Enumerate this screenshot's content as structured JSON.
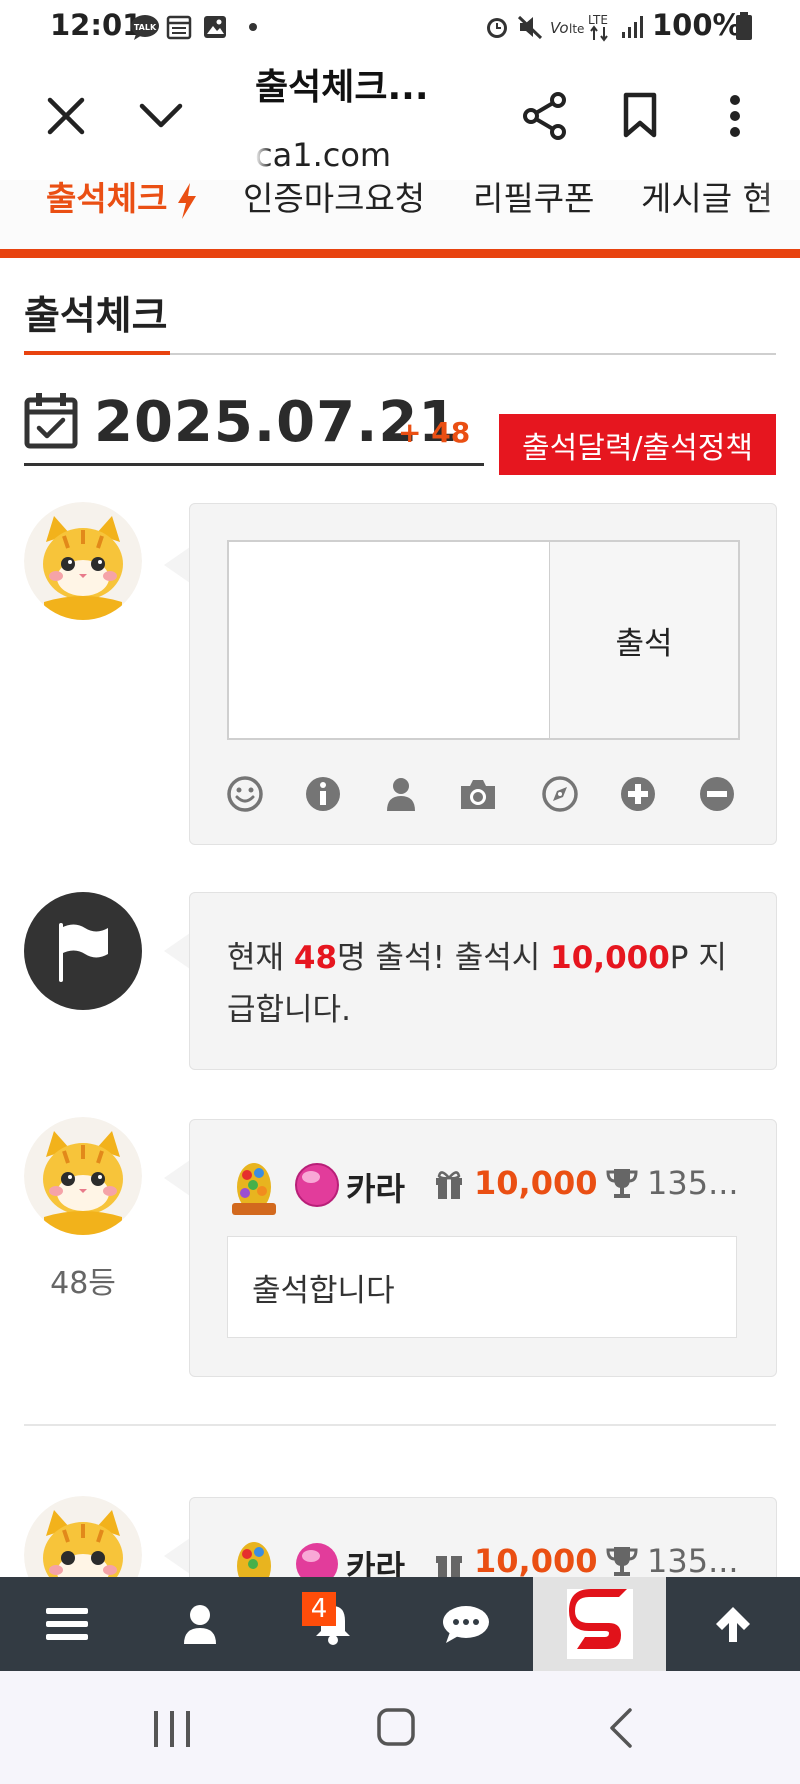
{
  "status_bar": {
    "time": "12:01",
    "battery": "100%",
    "icons": [
      "talk-icon",
      "calendar-icon",
      "gallery-icon",
      "dot-icon",
      "alarm-icon",
      "mute-icon",
      "volte-icon",
      "lte-icon",
      "signal-icon",
      "battery-icon"
    ]
  },
  "browser": {
    "title": "출석체크...",
    "url": "ca1.com"
  },
  "nav": {
    "items": [
      "출석체크",
      "인증마크요청",
      "리필쿠폰",
      "게시글 현"
    ],
    "active_index": 0,
    "accent": "#e8430f"
  },
  "section": {
    "title": "출석체크"
  },
  "date_row": {
    "date": "2025.07.21",
    "count": "+ 48",
    "calendar_button": "출석달력/출석정책"
  },
  "composer": {
    "submit_label": "출석",
    "tools": [
      "smile-icon",
      "info-icon",
      "user-icon",
      "camera-icon",
      "compass-icon",
      "plus-circle-icon",
      "minus-circle-icon"
    ]
  },
  "notice": {
    "prefix": "현재 ",
    "count": "48",
    "middle": "명 출석! 출석시 ",
    "points": "10,000",
    "suffix": "P 지급합니다."
  },
  "entries": [
    {
      "username": "카라",
      "points": "10,000",
      "trophy": "135...",
      "rank": "48등",
      "comment": "출석합니다"
    },
    {
      "username": "카라",
      "points": "10,000",
      "trophy": "135..."
    }
  ],
  "app_bar": {
    "notification_count": "4",
    "items": [
      "menu-icon",
      "user-icon",
      "bell-icon",
      "chat-icon",
      "site-logo",
      "arrow-up-icon"
    ]
  },
  "colors": {
    "accent_orange": "#ea4f13",
    "red": "#e6161f",
    "dark_bar": "#333b43"
  }
}
